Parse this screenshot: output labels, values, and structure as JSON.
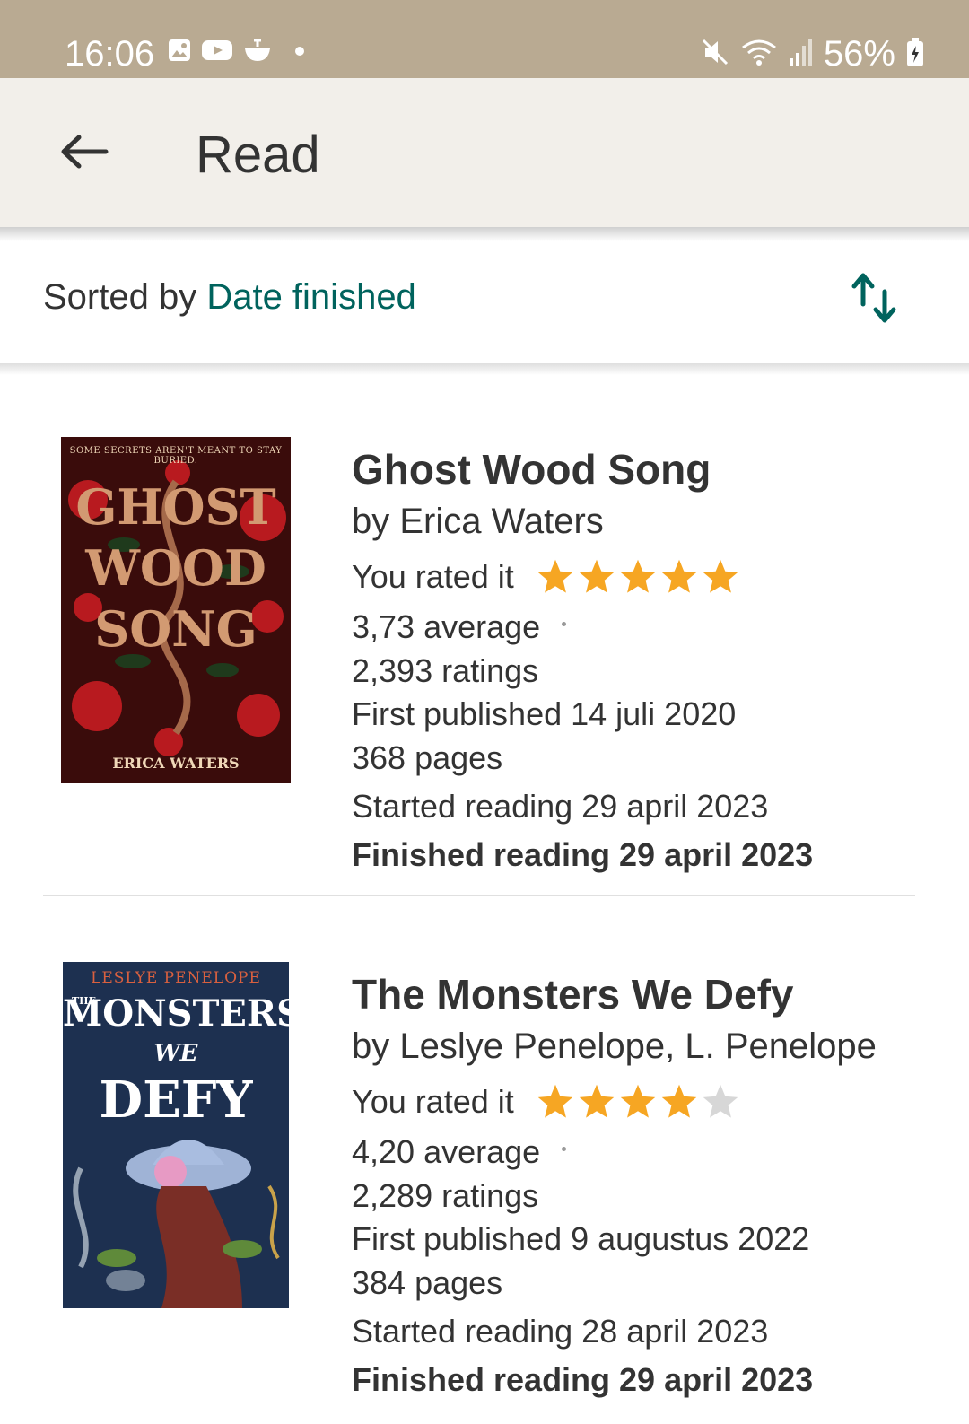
{
  "status_bar": {
    "time": "16:06",
    "left_icons": [
      "gallery-icon",
      "youtube-icon",
      "notification-app-icon",
      "dot-icon"
    ],
    "right_icons": [
      "mute-icon",
      "wifi-icon",
      "signal-icon",
      "battery-charging-icon"
    ],
    "battery": "56%"
  },
  "app_bar": {
    "back_icon": "arrow-left-icon",
    "title": "Read"
  },
  "sort": {
    "prefix": "Sorted by ",
    "value": "Date finished",
    "toggle_icon": "sort-direction-icon"
  },
  "colors": {
    "status_bar": "#b9aa92",
    "app_bar": "#f2efea",
    "accent": "#00635d",
    "star_filled": "#f6a623",
    "star_empty": "#d7d7d7"
  },
  "books": [
    {
      "title": "Ghost Wood Song",
      "author": "by Erica Waters",
      "rated_label": "You rated it",
      "rating": 5,
      "rating_max": 5,
      "average": "3,73 average",
      "ratings": "2,393 ratings",
      "first_published": "First published 14 juli 2020",
      "pages": "368 pages",
      "started": "Started reading 29 april 2023",
      "finished": "Finished reading 29 april 2023",
      "cover": {
        "tagline": "SOME SECRETS AREN'T MEANT TO STAY BURIED.",
        "title_lines": [
          "GHOST",
          "WOOD",
          "SONG"
        ],
        "author": "ERICA WATERS"
      }
    },
    {
      "title": "The Monsters We Defy",
      "author": "by Leslye Penelope, L. Penelope",
      "rated_label": "You rated it",
      "rating": 4,
      "rating_max": 5,
      "average": "4,20 average",
      "ratings": "2,289 ratings",
      "first_published": "First published 9 augustus 2022",
      "pages": "384 pages",
      "started": "Started reading 28 april 2023",
      "finished": "Finished reading 29 april 2023",
      "cover": {
        "author": "LESLYE PENELOPE",
        "title_lines": [
          "THE",
          "MONSTERS",
          "WE",
          "DEFY"
        ]
      }
    }
  ]
}
